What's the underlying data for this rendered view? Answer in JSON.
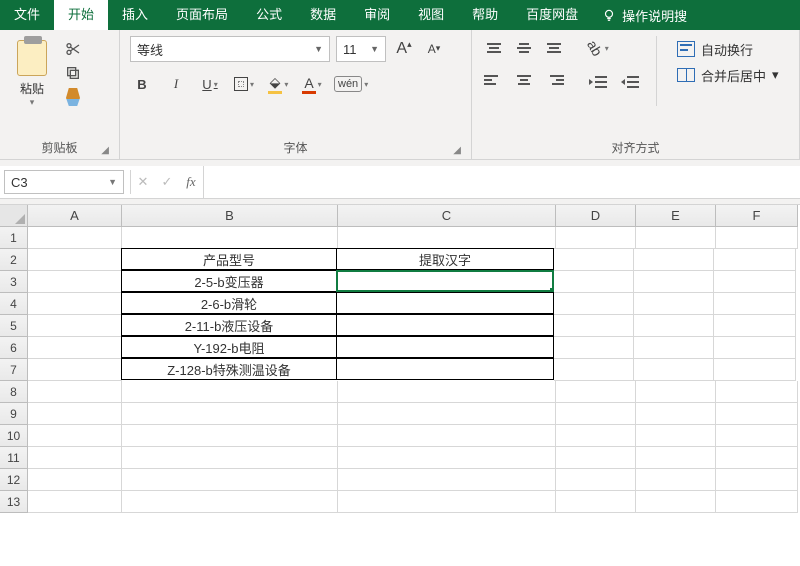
{
  "menu": {
    "file": "文件",
    "home": "开始",
    "insert": "插入",
    "layout": "页面布局",
    "formula": "公式",
    "data": "数据",
    "review": "审阅",
    "view": "视图",
    "help": "帮助",
    "baidu": "百度网盘",
    "tell": "操作说明搜"
  },
  "ribbon": {
    "clipboard_label": "剪贴板",
    "paste": "粘贴",
    "font_label": "字体",
    "font_name": "等线",
    "font_size": "11",
    "align_label": "对齐方式",
    "wrap": "自动换行",
    "merge": "合并后居中"
  },
  "namebox": "C3",
  "columns": [
    "A",
    "B",
    "C",
    "D",
    "E",
    "F"
  ],
  "rows": [
    "1",
    "2",
    "3",
    "4",
    "5",
    "6",
    "7",
    "8",
    "9",
    "10",
    "11",
    "12",
    "13"
  ],
  "grid": {
    "B2": "产品型号",
    "C2": "提取汉字",
    "B3": "2-5-b变压器",
    "B4": "2-6-b滑轮",
    "B5": "2-11-b液压设备",
    "B6": "Y-192-b电阻",
    "B7": "Z-128-b特殊测温设备"
  }
}
